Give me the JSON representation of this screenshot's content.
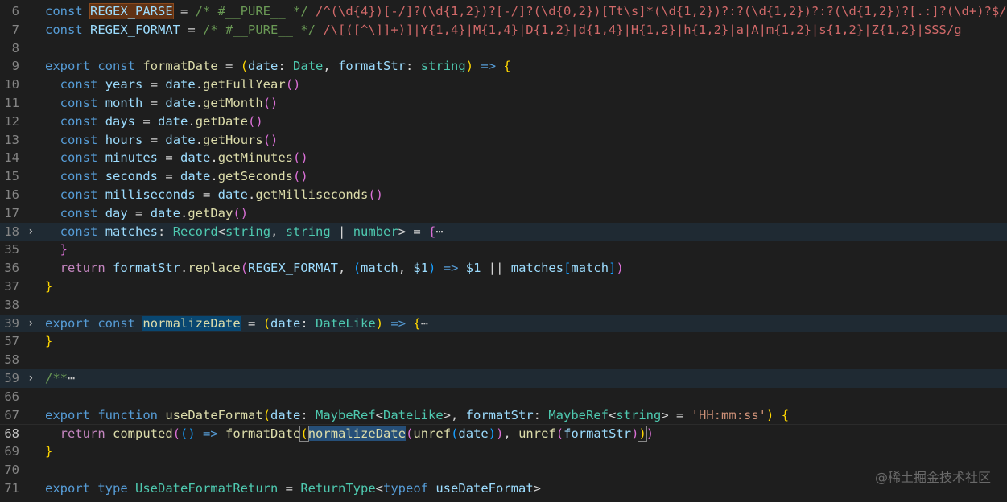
{
  "editor": {
    "lines": [
      {
        "n": "6",
        "html": "<span class=\"kw\">const</span> <span class=\"var hl-word\">REGEX_PARSE</span> = <span class=\"cmt\">/* #__PURE__ */</span> <span class=\"rx\">/^(\\d{4})[-/]?(\\d{1,2})?[-/]?(\\d{0,2})[Tt\\s]*(\\d{1,2})?:?(\\d{1,2})?:?(\\d{1,2})?[.:]?(\\d+)?$/</span>"
      },
      {
        "n": "7",
        "html": "<span class=\"kw\">const</span> <span class=\"var\">REGEX_FORMAT</span> = <span class=\"cmt\">/* #__PURE__ */</span> <span class=\"rx\">/\\[([^\\]]+)]|Y{1,4}|M{1,4}|D{1,2}|d{1,4}|H{1,2}|h{1,2}|a|A|m{1,2}|s{1,2}|Z{1,2}|SSS/g</span>"
      },
      {
        "n": "8",
        "html": ""
      },
      {
        "n": "9",
        "html": "<span class=\"kw\">export</span> <span class=\"kw\">const</span> <span class=\"fn\">formatDate</span> = <span class=\"b1\">(</span><span class=\"var\">date</span>: <span class=\"type\">Date</span>, <span class=\"var\">formatStr</span>: <span class=\"type\">string</span><span class=\"b1\">)</span> <span class=\"kw\">=&gt;</span> <span class=\"b1\">{</span>"
      },
      {
        "n": "10",
        "html": "  <span class=\"kw\">const</span> <span class=\"var\">years</span> = <span class=\"var\">date</span>.<span class=\"fn\">getFullYear</span><span class=\"b2\">()</span>"
      },
      {
        "n": "11",
        "html": "  <span class=\"kw\">const</span> <span class=\"var\">month</span> = <span class=\"var\">date</span>.<span class=\"fn\">getMonth</span><span class=\"b2\">()</span>"
      },
      {
        "n": "12",
        "html": "  <span class=\"kw\">const</span> <span class=\"var\">days</span> = <span class=\"var\">date</span>.<span class=\"fn\">getDate</span><span class=\"b2\">()</span>"
      },
      {
        "n": "13",
        "html": "  <span class=\"kw\">const</span> <span class=\"var\">hours</span> = <span class=\"var\">date</span>.<span class=\"fn\">getHours</span><span class=\"b2\">()</span>"
      },
      {
        "n": "14",
        "html": "  <span class=\"kw\">const</span> <span class=\"var\">minutes</span> = <span class=\"var\">date</span>.<span class=\"fn\">getMinutes</span><span class=\"b2\">()</span>"
      },
      {
        "n": "15",
        "html": "  <span class=\"kw\">const</span> <span class=\"var\">seconds</span> = <span class=\"var\">date</span>.<span class=\"fn\">getSeconds</span><span class=\"b2\">()</span>"
      },
      {
        "n": "16",
        "html": "  <span class=\"kw\">const</span> <span class=\"var\">milliseconds</span> = <span class=\"var\">date</span>.<span class=\"fn\">getMilliseconds</span><span class=\"b2\">()</span>"
      },
      {
        "n": "17",
        "html": "  <span class=\"kw\">const</span> <span class=\"var\">day</span> = <span class=\"var\">date</span>.<span class=\"fn\">getDay</span><span class=\"b2\">()</span>"
      },
      {
        "n": "18",
        "fold": true,
        "bg": true,
        "html": "  <span class=\"kw\">const</span> <span class=\"var\">matches</span>: <span class=\"type\">Record</span>&lt;<span class=\"type\">string</span>, <span class=\"type\">string</span> | <span class=\"type\">number</span>&gt; = <span class=\"b2\">{</span><span class=\"ellipsis\">⋯</span>"
      },
      {
        "n": "35",
        "html": "  <span class=\"b2\">}</span>"
      },
      {
        "n": "36",
        "html": "  <span class=\"ctrl\">return</span> <span class=\"var\">formatStr</span>.<span class=\"fn\">replace</span><span class=\"b2\">(</span><span class=\"var\">REGEX_FORMAT</span>, <span class=\"b3\">(</span><span class=\"var\">match</span>, <span class=\"var\">$1</span><span class=\"b3\">)</span> <span class=\"kw\">=&gt;</span> <span class=\"var\">$1</span> || <span class=\"var\">matches</span><span class=\"b3\">[</span><span class=\"var\">match</span><span class=\"b3\">]</span><span class=\"b2\">)</span>"
      },
      {
        "n": "37",
        "html": "<span class=\"b1\">}</span>"
      },
      {
        "n": "38",
        "html": ""
      },
      {
        "n": "39",
        "fold": true,
        "bg": true,
        "html": "<span class=\"kw\">export</span> <span class=\"kw\">const</span> <span class=\"fn hl-match\">normalizeDate</span> = <span class=\"b1\">(</span><span class=\"var\">date</span>: <span class=\"type\">DateLike</span><span class=\"b1\">)</span> <span class=\"kw\">=&gt;</span> <span class=\"b1\">{</span><span class=\"ellipsis\">⋯</span>"
      },
      {
        "n": "57",
        "html": "<span class=\"b1\">}</span>"
      },
      {
        "n": "58",
        "html": ""
      },
      {
        "n": "59",
        "fold": true,
        "bg": true,
        "html": "<span class=\"cmt\">/**</span><span class=\"ellipsis\">⋯</span>"
      },
      {
        "n": "66",
        "html": ""
      },
      {
        "n": "67",
        "html": "<span class=\"kw\">export</span> <span class=\"kw\">function</span> <span class=\"fn\">useDateFormat</span><span class=\"b1\">(</span><span class=\"var\">date</span>: <span class=\"type\">MaybeRef</span>&lt;<span class=\"type\">DateLike</span>&gt;, <span class=\"var\">formatStr</span>: <span class=\"type\">MaybeRef</span>&lt;<span class=\"type\">string</span>&gt; = <span class=\"str\">'HH:mm:ss'</span><span class=\"b1\">)</span> <span class=\"b1\">{</span>"
      },
      {
        "n": "68",
        "current": true,
        "html": "  <span class=\"ctrl\">return</span> <span class=\"fn\">computed</span><span class=\"b2\">(</span><span class=\"b3\">()</span> <span class=\"kw\">=&gt;</span> <span class=\"fn\">formatDate</span><span class=\"b1 bracket-box\">(</span><span class=\"fn hl-sel\">normalizeDate</span><span class=\"b2\">(</span><span class=\"fn\">unref</span><span class=\"b3\">(</span><span class=\"var\">date</span><span class=\"b3\">)</span><span class=\"b2\">)</span>, <span class=\"fn\">unref</span><span class=\"b2\">(</span><span class=\"var\">formatStr</span><span class=\"b2\">)</span><span class=\"b1 bracket-box\">)</span><span class=\"b2\">)</span>"
      },
      {
        "n": "69",
        "html": "<span class=\"b1\">}</span>"
      },
      {
        "n": "70",
        "html": ""
      },
      {
        "n": "71",
        "html": "<span class=\"kw\">export</span> <span class=\"kw\">type</span> <span class=\"type\">UseDateFormatReturn</span> = <span class=\"type\">ReturnType</span>&lt;<span class=\"kw\">typeof</span> <span class=\"var\">useDateFormat</span>&gt;"
      }
    ]
  },
  "watermark": "@稀土掘金技术社区"
}
